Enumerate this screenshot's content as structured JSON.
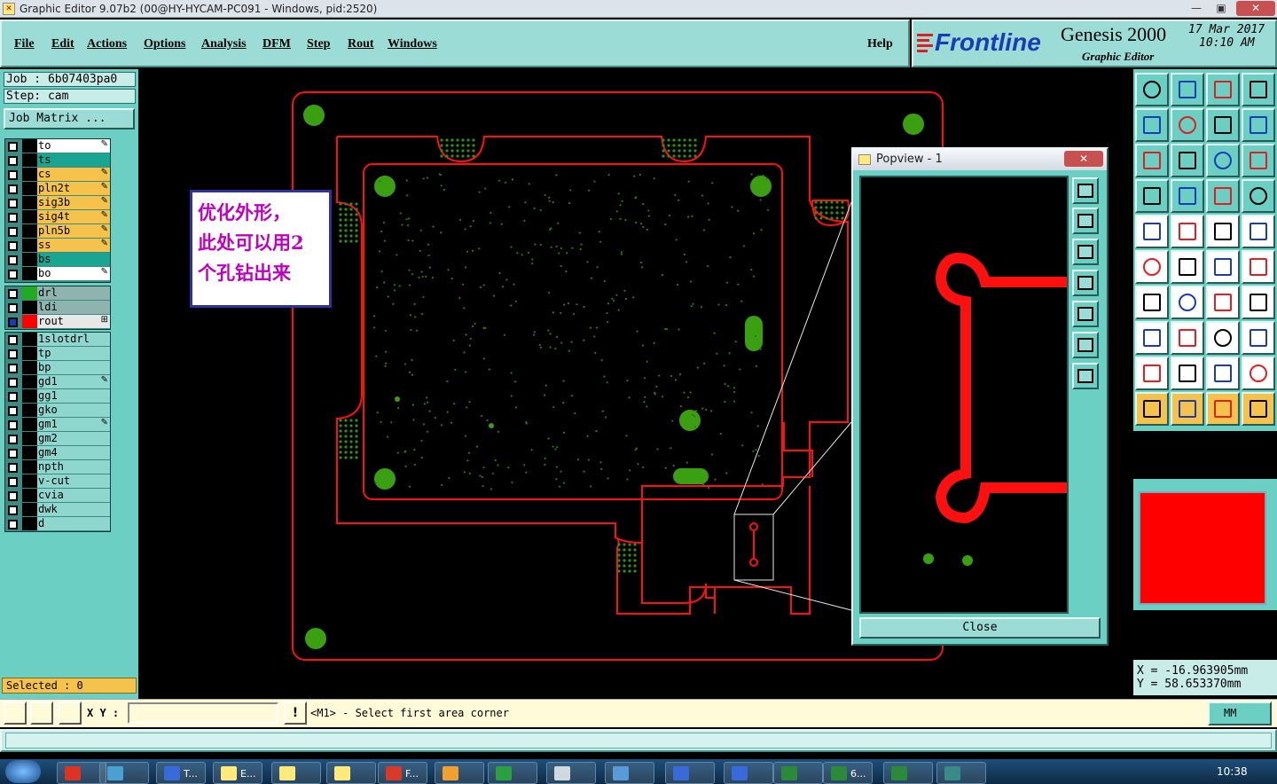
{
  "window": {
    "title": "Graphic Editor 9.07b2 (00@HY-HYCAM-PC091 - Windows, pid:2520)",
    "minimize": "—",
    "maximize": "▣",
    "close": "✕"
  },
  "menu": {
    "items": [
      "File",
      "Edit",
      "Actions",
      "Options",
      "Analysis",
      "DFM",
      "Step",
      "Rout",
      "Windows"
    ],
    "help": "Help"
  },
  "brand": {
    "logo": "Frontline",
    "product": "Genesis 2000",
    "subtitle": "Graphic Editor",
    "date": "17 Mar 2017",
    "time": "10:10 AM"
  },
  "job": {
    "job_label": "Job : 6b07403pa0",
    "step_label": "Step: cam",
    "matrix_button": "Job Matrix ..."
  },
  "layers_board": [
    {
      "name": "to",
      "color": "#ffffff",
      "mark": "✎"
    },
    {
      "name": "ts",
      "color": "#1aa592",
      "mark": ""
    },
    {
      "name": "cs",
      "color": "#f5c34c",
      "mark": "✎"
    },
    {
      "name": "pln2t",
      "color": "#f5c34c",
      "mark": "✎"
    },
    {
      "name": "sig3b",
      "color": "#f5c34c",
      "mark": "✎"
    },
    {
      "name": "sig4t",
      "color": "#f5c34c",
      "mark": "✎"
    },
    {
      "name": "pln5b",
      "color": "#f5c34c",
      "mark": "✎"
    },
    {
      "name": "ss",
      "color": "#f5c34c",
      "mark": "✎"
    },
    {
      "name": "bs",
      "color": "#1aa592",
      "mark": ""
    },
    {
      "name": "bo",
      "color": "#ffffff",
      "mark": "✎"
    }
  ],
  "layers_drill": [
    {
      "name": "drl",
      "color": "#8fb4b0",
      "swatch": "#22aa22",
      "mark": ""
    },
    {
      "name": "ldi",
      "color": "#8fb4b0",
      "swatch": "",
      "mark": ""
    },
    {
      "name": "rout",
      "color": "#e8e8e8",
      "swatch": "#ff0000",
      "mark": "⊞"
    }
  ],
  "layers_misc": [
    {
      "name": "1slotdrl",
      "mark": ""
    },
    {
      "name": "tp",
      "mark": ""
    },
    {
      "name": "bp",
      "mark": ""
    },
    {
      "name": "gd1",
      "mark": "✎"
    },
    {
      "name": "gg1",
      "mark": ""
    },
    {
      "name": "gko",
      "mark": ""
    },
    {
      "name": "gm1",
      "mark": "✎"
    },
    {
      "name": "gm2",
      "mark": ""
    },
    {
      "name": "gm4",
      "mark": ""
    },
    {
      "name": "npth",
      "mark": ""
    },
    {
      "name": "v-cut",
      "mark": ""
    },
    {
      "name": "cvia",
      "mark": ""
    },
    {
      "name": "dwk",
      "mark": ""
    },
    {
      "name": "d",
      "mark": ""
    }
  ],
  "selected": "Selected : 0",
  "annotation": {
    "line1": "优化外形，",
    "line2": "此处可以用2",
    "line3": "个孔钻出来"
  },
  "popview": {
    "title": "Popview - 1",
    "close_label": "Close"
  },
  "coords": {
    "x": "X = -16.963905mm",
    "y": "Y =  58.653370mm"
  },
  "command": {
    "xy_label": "X Y :",
    "xy_value": "",
    "alert_icon": "!",
    "prompt": "<M1> - Select first area corner",
    "units": "MM"
  },
  "taskbar": {
    "clock": "10:38",
    "tasks": [
      {
        "label": "",
        "color": "#dd3322"
      },
      {
        "label": "",
        "color": "#4aa0d0"
      },
      {
        "label": "T...",
        "color": "#3a6ad8"
      },
      {
        "label": "E...",
        "color": "#ffe97a"
      },
      {
        "label": "",
        "color": "#ffe97a"
      },
      {
        "label": "",
        "color": "#ffe97a"
      },
      {
        "label": "F...",
        "color": "#d83a2a"
      },
      {
        "label": "",
        "color": "#f0a030"
      },
      {
        "label": "",
        "color": "#2aa040"
      },
      {
        "label": "",
        "color": "#d0d8e0"
      },
      {
        "label": "",
        "color": "#5a9ad8"
      },
      {
        "label": "",
        "color": "#3a6ad8"
      },
      {
        "label": "",
        "color": "#3a6ad8"
      },
      {
        "label": "",
        "color": "#2a8a3a"
      },
      {
        "label": "6...",
        "color": "#2a8a3a"
      },
      {
        "label": "",
        "color": "#2a8a3a"
      },
      {
        "label": "",
        "color": "#3a8a8a"
      }
    ]
  },
  "colors": {
    "panel": "#6ccfc4",
    "board_outline": "#ff0000",
    "pads": "#3aa012"
  }
}
